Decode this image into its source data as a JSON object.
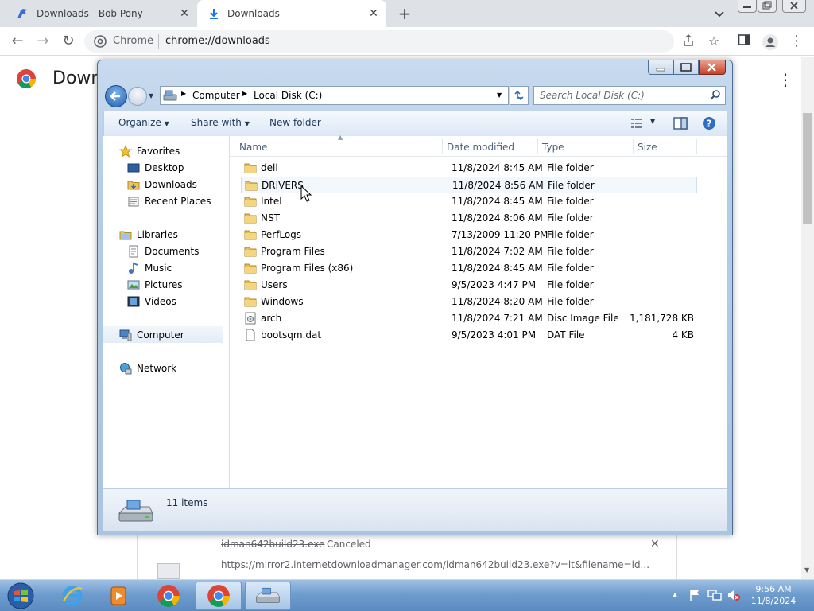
{
  "browser": {
    "tabs": [
      {
        "title": "Downloads - Bob Pony",
        "active": false
      },
      {
        "title": "Downloads",
        "active": true
      }
    ],
    "site_label": "Chrome",
    "url": "chrome://downloads",
    "page_heading": "Down"
  },
  "download_item": {
    "filename": "idman642build23.exe",
    "status": "Canceled",
    "source_url": "https://mirror2.internetdownloadmanager.com/idman642build23.exe?v=lt&filename=id..."
  },
  "explorer": {
    "breadcrumb": [
      "Computer",
      "Local Disk (C:)"
    ],
    "search_placeholder": "Search Local Disk (C:)",
    "commands": {
      "organize": "Organize",
      "share_with": "Share with",
      "new_folder": "New folder"
    },
    "nav": {
      "favorites": "Favorites",
      "favorites_items": [
        "Desktop",
        "Downloads",
        "Recent Places"
      ],
      "libraries": "Libraries",
      "libraries_items": [
        "Documents",
        "Music",
        "Pictures",
        "Videos"
      ],
      "computer": "Computer",
      "network": "Network"
    },
    "columns": {
      "name": "Name",
      "date": "Date modified",
      "type": "Type",
      "size": "Size"
    },
    "files": [
      {
        "name": "dell",
        "date": "11/8/2024 8:45 AM",
        "type": "File folder",
        "size": "",
        "icon": "folder"
      },
      {
        "name": "DRIVERS",
        "date": "11/8/2024 8:56 AM",
        "type": "File folder",
        "size": "",
        "icon": "folder"
      },
      {
        "name": "Intel",
        "date": "11/8/2024 8:45 AM",
        "type": "File folder",
        "size": "",
        "icon": "folder"
      },
      {
        "name": "NST",
        "date": "11/8/2024 8:06 AM",
        "type": "File folder",
        "size": "",
        "icon": "folder"
      },
      {
        "name": "PerfLogs",
        "date": "7/13/2009 11:20 PM",
        "type": "File folder",
        "size": "",
        "icon": "folder"
      },
      {
        "name": "Program Files",
        "date": "11/8/2024 7:02 AM",
        "type": "File folder",
        "size": "",
        "icon": "folder"
      },
      {
        "name": "Program Files (x86)",
        "date": "11/8/2024 8:45 AM",
        "type": "File folder",
        "size": "",
        "icon": "folder"
      },
      {
        "name": "Users",
        "date": "9/5/2023 4:47 PM",
        "type": "File folder",
        "size": "",
        "icon": "folder"
      },
      {
        "name": "Windows",
        "date": "11/8/2024 8:20 AM",
        "type": "File folder",
        "size": "",
        "icon": "folder"
      },
      {
        "name": "arch",
        "date": "11/8/2024 7:21 AM",
        "type": "Disc Image File",
        "size": "1,181,728 KB",
        "icon": "disc-image"
      },
      {
        "name": "bootsqm.dat",
        "date": "9/5/2023 4:01 PM",
        "type": "DAT File",
        "size": "4 KB",
        "icon": "file"
      }
    ],
    "status_count": "11 items"
  },
  "taskbar": {
    "time": "9:56 AM",
    "date": "11/8/2024"
  }
}
